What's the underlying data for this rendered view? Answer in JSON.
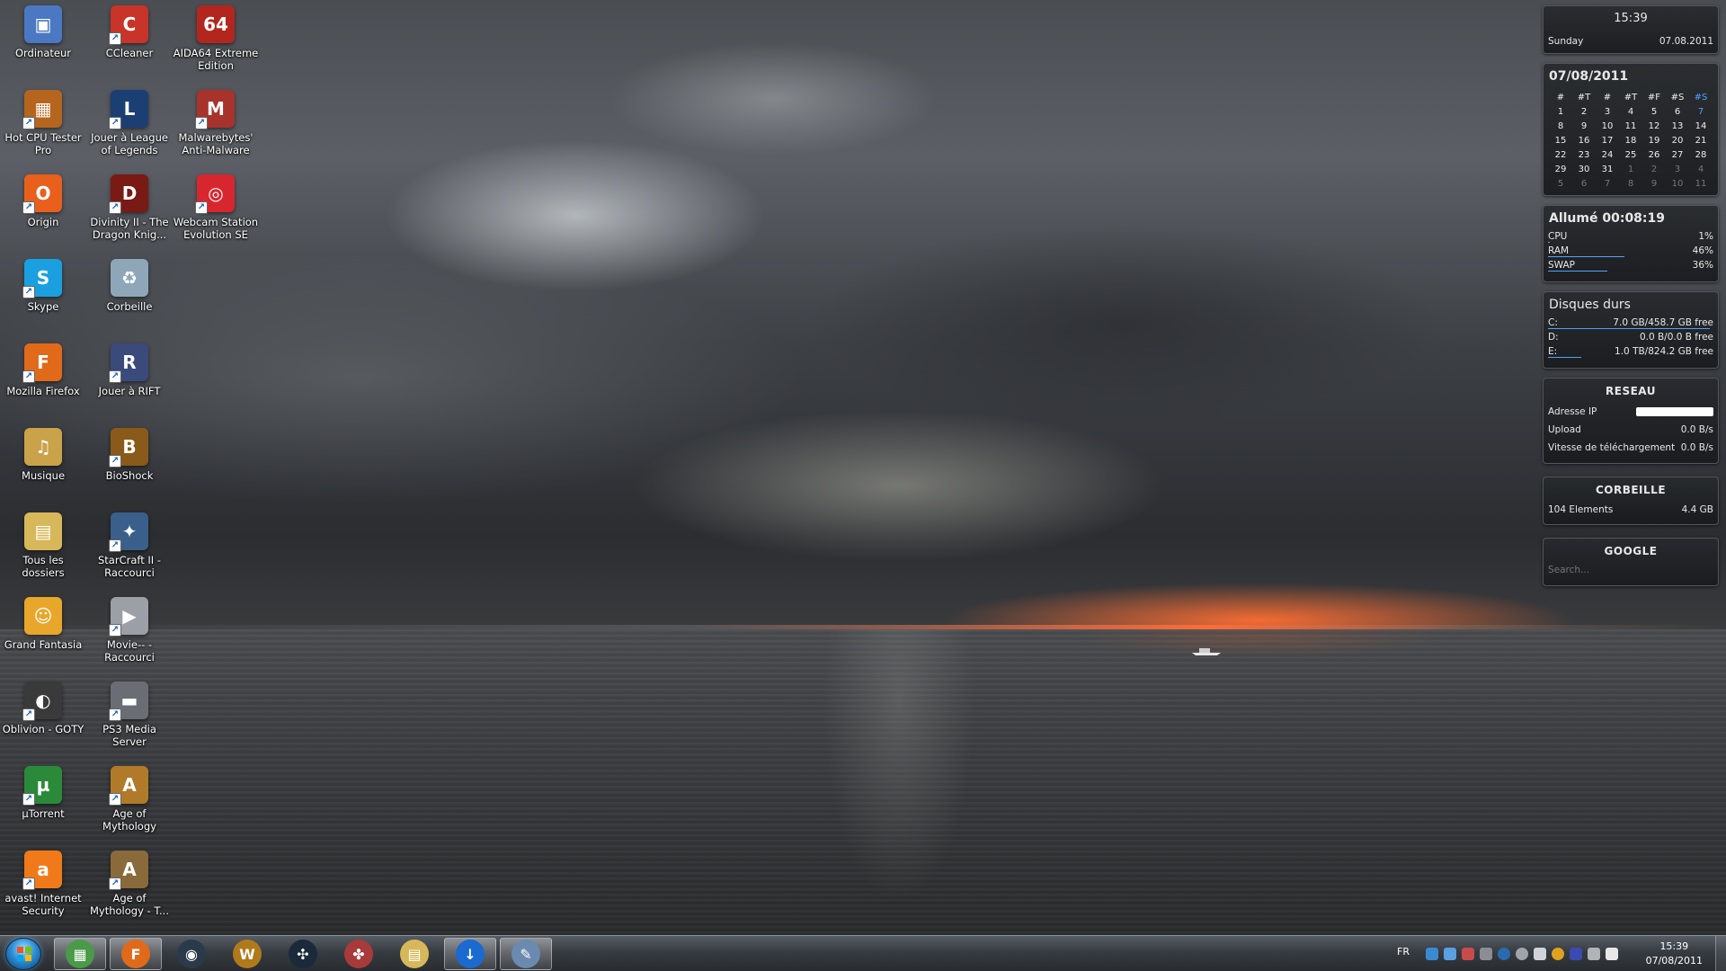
{
  "desktop_icons": [
    {
      "label": "Ordinateur",
      "icon": "computer-icon",
      "color": "#4a78c2",
      "glyph": "▣",
      "shortcut": false
    },
    {
      "label": "CCleaner",
      "icon": "ccleaner-icon",
      "color": "#c8342a",
      "glyph": "C",
      "shortcut": true
    },
    {
      "label": "AIDA64 Extreme Edition",
      "icon": "aida64-icon",
      "color": "#b3261e",
      "glyph": "64",
      "shortcut": false
    },
    {
      "label": "Hot CPU Tester Pro",
      "icon": "hot-cpu-tester-icon",
      "color": "#b5651d",
      "glyph": "▦",
      "shortcut": true
    },
    {
      "label": "Jouer à League of Legends",
      "icon": "league-of-legends-icon",
      "color": "#1c3f73",
      "glyph": "L",
      "shortcut": true
    },
    {
      "label": "Malwarebytes' Anti-Malware",
      "icon": "malwarebytes-icon",
      "color": "#a8332c",
      "glyph": "M",
      "shortcut": true
    },
    {
      "label": "Origin",
      "icon": "origin-icon",
      "color": "#e8601c",
      "glyph": "O",
      "shortcut": true
    },
    {
      "label": "Divinity II - The Dragon Knig...",
      "icon": "divinity-icon",
      "color": "#7a1a14",
      "glyph": "D",
      "shortcut": true
    },
    {
      "label": "Webcam Station Evolution SE",
      "icon": "webcam-icon",
      "color": "#d8262e",
      "glyph": "◎",
      "shortcut": true
    },
    {
      "label": "Skype",
      "icon": "skype-icon",
      "color": "#1aa0e0",
      "glyph": "S",
      "shortcut": true
    },
    {
      "label": "Corbeille",
      "icon": "recycle-bin-icon",
      "color": "#8fa6b8",
      "glyph": "♻",
      "shortcut": false
    },
    {
      "label": "",
      "icon": "",
      "color": "",
      "glyph": "",
      "shortcut": false
    },
    {
      "label": "Mozilla Firefox",
      "icon": "firefox-icon",
      "color": "#e06a1a",
      "glyph": "F",
      "shortcut": true
    },
    {
      "label": "Jouer à RIFT",
      "icon": "rift-icon",
      "color": "#3a4a7a",
      "glyph": "R",
      "shortcut": true
    },
    {
      "label": "",
      "icon": "",
      "color": "",
      "glyph": "",
      "shortcut": false
    },
    {
      "label": "Musique",
      "icon": "music-folder-icon",
      "color": "#c9a24a",
      "glyph": "♫",
      "shortcut": false
    },
    {
      "label": "BioShock",
      "icon": "bioshock-icon",
      "color": "#8a5a1a",
      "glyph": "B",
      "shortcut": true
    },
    {
      "label": "",
      "icon": "",
      "color": "",
      "glyph": "",
      "shortcut": false
    },
    {
      "label": "Tous les dossiers",
      "icon": "folders-icon",
      "color": "#d6b85a",
      "glyph": "▤",
      "shortcut": false
    },
    {
      "label": "StarCraft II - Raccourci",
      "icon": "starcraft-icon",
      "color": "#3a5f8a",
      "glyph": "✦",
      "shortcut": true
    },
    {
      "label": "",
      "icon": "",
      "color": "",
      "glyph": "",
      "shortcut": false
    },
    {
      "label": "Grand Fantasia",
      "icon": "grand-fantasia-icon",
      "color": "#e8a62a",
      "glyph": "☺",
      "shortcut": false
    },
    {
      "label": "Movie-- - Raccourci",
      "icon": "movie-icon",
      "color": "#9aa0a6",
      "glyph": "▶",
      "shortcut": true
    },
    {
      "label": "",
      "icon": "",
      "color": "",
      "glyph": "",
      "shortcut": false
    },
    {
      "label": "Oblivion - GOTY",
      "icon": "oblivion-icon",
      "color": "#3a3a3a",
      "glyph": "◐",
      "shortcut": true
    },
    {
      "label": "PS3 Media Server",
      "icon": "ps3-media-server-icon",
      "color": "#6a6e74",
      "glyph": "▬",
      "shortcut": true
    },
    {
      "label": "",
      "icon": "",
      "color": "",
      "glyph": "",
      "shortcut": false
    },
    {
      "label": "µTorrent",
      "icon": "utorrent-icon",
      "color": "#2a8a3a",
      "glyph": "µ",
      "shortcut": true
    },
    {
      "label": "Age of Mythology",
      "icon": "age-of-mythology-icon",
      "color": "#b07a2a",
      "glyph": "A",
      "shortcut": true
    },
    {
      "label": "",
      "icon": "",
      "color": "",
      "glyph": "",
      "shortcut": false
    },
    {
      "label": "avast! Internet Security",
      "icon": "avast-icon",
      "color": "#f07a1a",
      "glyph": "a",
      "shortcut": true
    },
    {
      "label": "Age of Mythology - T...",
      "icon": "age-of-mythology-titans-icon",
      "color": "#8a6a3a",
      "glyph": "A",
      "shortcut": true
    }
  ],
  "clock_gadget": {
    "time": "15:39",
    "day": "Sunday",
    "date": "07.08.2011"
  },
  "calendar": {
    "title": "07/08/2011",
    "headers": [
      "#",
      "#T",
      "#",
      "#T",
      "#F",
      "#S",
      "#S"
    ],
    "cells": [
      [
        "1",
        "2",
        "3",
        "4",
        "5",
        "6",
        "7"
      ],
      [
        "8",
        "9",
        "10",
        "11",
        "12",
        "13",
        "14"
      ],
      [
        "15",
        "16",
        "17",
        "18",
        "19",
        "20",
        "21"
      ],
      [
        "22",
        "23",
        "24",
        "25",
        "26",
        "27",
        "28"
      ],
      [
        "29",
        "30",
        "31",
        "1",
        "2",
        "3",
        "4"
      ],
      [
        "5",
        "6",
        "7",
        "8",
        "9",
        "10",
        "11"
      ]
    ],
    "highlight_color": "#4da3ff"
  },
  "system": {
    "title": "Allumé 00:08:19",
    "rows": [
      {
        "label": "CPU",
        "value": "1%",
        "level": 0.01
      },
      {
        "label": "RAM",
        "value": "46%",
        "level": 0.46
      },
      {
        "label": "SWAP",
        "value": "36%",
        "level": 0.36
      }
    ]
  },
  "disks": {
    "title": "Disques durs",
    "rows": [
      {
        "label": "C:",
        "value": "7.0 GB/458.7 GB free",
        "level": 0.98
      },
      {
        "label": "D:",
        "value": "0.0 B/0.0 B free",
        "level": 0.0
      },
      {
        "label": "E:",
        "value": "1.0 TB/824.2 GB free",
        "level": 0.2
      }
    ]
  },
  "network": {
    "title": "RESEAU",
    "ip_label": "Adresse IP",
    "upload_label": "Upload",
    "upload_value": "0.0 B/s",
    "download_label": "Vitesse de téléchargement",
    "download_value": "0.0 B/s"
  },
  "recycle": {
    "title": "CORBEILLE",
    "count": "104 Elements",
    "size": "4.4 GB"
  },
  "google": {
    "title": "GOOGLE",
    "placeholder": "Search..."
  },
  "taskbar": {
    "apps": [
      {
        "icon": "control-panel-icon",
        "color": "#4a9a4a",
        "glyph": "▦",
        "active": true
      },
      {
        "icon": "firefox-icon",
        "color": "#e06a1a",
        "glyph": "F",
        "active": true
      },
      {
        "icon": "steam-icon",
        "color": "#2a3a4a",
        "glyph": "◉",
        "active": false
      },
      {
        "icon": "warcraft-icon",
        "color": "#b07a1a",
        "glyph": "W",
        "active": false
      },
      {
        "icon": "fan-icon",
        "color": "#1a2a3a",
        "glyph": "✣",
        "active": false
      },
      {
        "icon": "molecule-icon",
        "color": "#a83a3a",
        "glyph": "✤",
        "active": false
      },
      {
        "icon": "explorer-icon",
        "color": "#d6b85a",
        "glyph": "▤",
        "active": false
      },
      {
        "icon": "download-icon",
        "color": "#1a6ad0",
        "glyph": "↓",
        "active": true
      },
      {
        "icon": "paint-icon",
        "color": "#6a8ab0",
        "glyph": "✎",
        "active": true
      }
    ],
    "language": "FR",
    "time": "15:39",
    "date": "07/08/2011"
  }
}
